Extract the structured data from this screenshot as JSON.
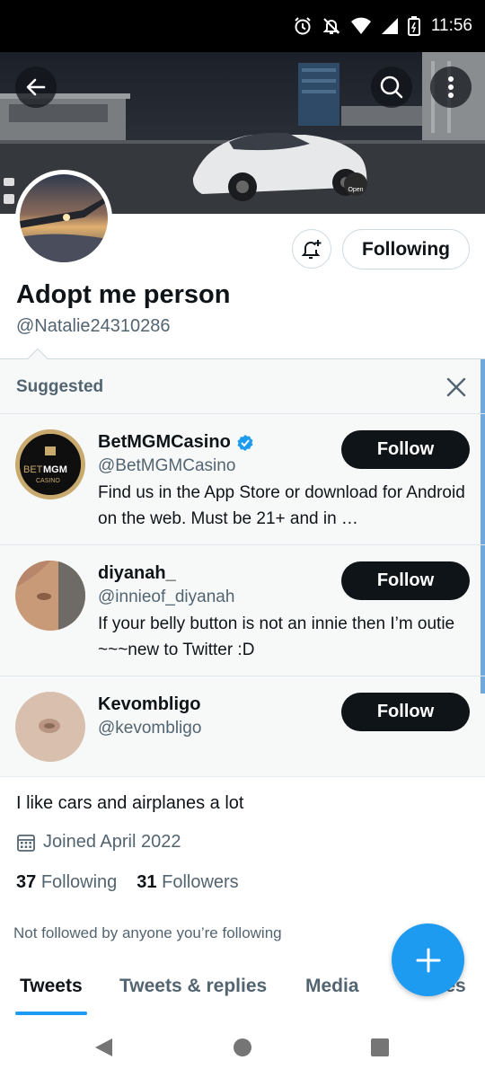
{
  "status_bar": {
    "time": "11:56"
  },
  "profile": {
    "name": "Adopt me person",
    "handle": "@Natalie24310286",
    "following_button": "Following",
    "bio": "I like cars and airplanes a lot",
    "joined": "Joined April 2022",
    "following_count": "37",
    "following_label": "Following",
    "followers_count": "31",
    "followers_label": "Followers",
    "not_followed_text": "Not followed by anyone you’re following"
  },
  "banner": {
    "open_badge": "Open"
  },
  "suggested": {
    "title": "Suggested",
    "items": [
      {
        "name": "BetMGMCasino",
        "handle": "@BetMGMCasino",
        "bio": "Find us in the App Store or download for Android on the web. Must be 21+ and in …",
        "follow_label": "Follow",
        "verified": true,
        "avatar_text_1": "BET",
        "avatar_text_2": "MGM",
        "avatar_text_3": "CASINO"
      },
      {
        "name": "diyanah_",
        "handle": "@innieof_diyanah",
        "bio": "If your belly button is not an innie then I’m outie ~~~new to Twitter :D",
        "follow_label": "Follow"
      },
      {
        "name": "Kevombligo",
        "handle": "@kevombligo",
        "follow_label": "Follow"
      }
    ]
  },
  "tabs": [
    "Tweets",
    "Tweets & replies",
    "Media",
    "Likes"
  ],
  "colors": {
    "accent": "#1d9bf0",
    "text": "#0f1419",
    "secondary": "#536471",
    "follow_button": "#0f1419",
    "suggested_bg": "#f7f9f9",
    "verified": "#1d9bf0"
  },
  "icons": [
    "alarm-icon",
    "mute-icon",
    "wifi-icon",
    "signal-icon",
    "battery-icon",
    "back-arrow-icon",
    "search-icon",
    "more-vertical-icon",
    "bell-plus-icon",
    "close-icon",
    "verified-badge-icon",
    "calendar-icon",
    "compose-plus-icon",
    "nav-back-icon",
    "nav-home-icon",
    "nav-recents-icon"
  ]
}
